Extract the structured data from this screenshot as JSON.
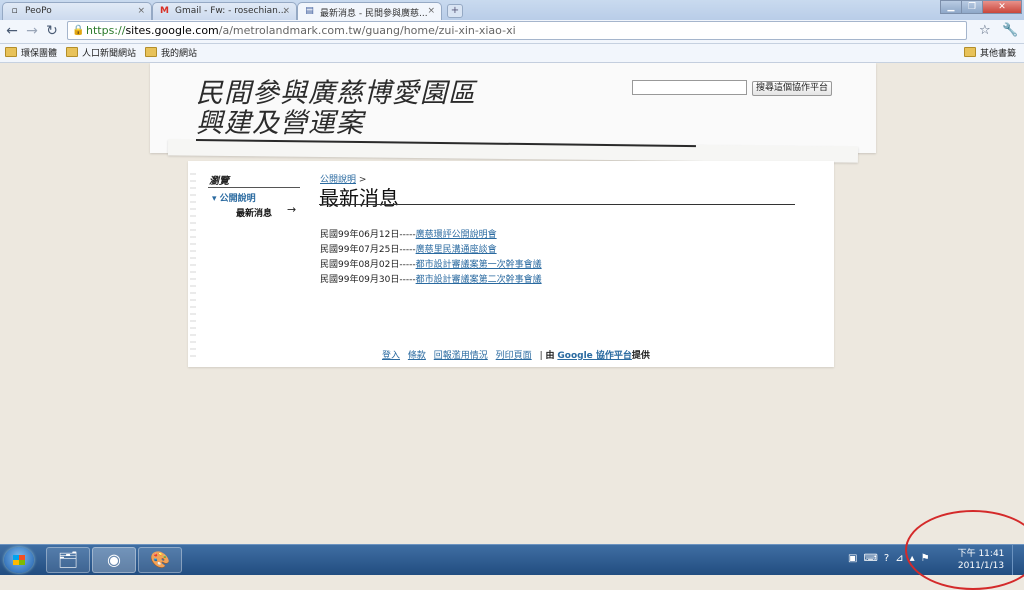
{
  "tabs": [
    {
      "title": "PeoPo",
      "icon": "page-icon"
    },
    {
      "title": "Gmail - Fw: - rosechian...",
      "icon": "gmail-icon"
    },
    {
      "title": "最新消息 - 民間參與廣慈...",
      "icon": "sites-icon"
    }
  ],
  "toolbar": {
    "url_secure": "https://",
    "url_host": "sites.google.com",
    "url_path": "/a/metrolandmark.com.tw/guang/home/zui-xin-xiao-xi"
  },
  "bookmarks": [
    "環保團體",
    "人口新聞網站",
    "我的網站"
  ],
  "other_bookmarks": "其他書籤",
  "site": {
    "title_line1": "民間參與廣慈博愛園區",
    "title_line2": "興建及營運案",
    "search_button": "搜尋這個協作平台"
  },
  "nav": {
    "title": "瀏覽",
    "item": "公開說明",
    "subitem": "最新消息"
  },
  "breadcrumb": {
    "link": "公開說明",
    "sep": " >"
  },
  "page_title": "最新消息",
  "news": [
    {
      "date": "民國99年06月12日-----",
      "link": "廣慈環評公開說明會"
    },
    {
      "date": "民國99年07月25日-----",
      "link": "廣慈里民溝通座談會"
    },
    {
      "date": "民國99年08月02日-----",
      "link": "都市設計審議案第一次幹事會議"
    },
    {
      "date": "民國99年09月30日-----",
      "link": "都市設計審議案第二次幹事會議"
    }
  ],
  "footer": {
    "links": [
      "登入",
      "條款",
      "回報濫用情況",
      "列印頁面"
    ],
    "sep": "|",
    "by": "由",
    "google_link": "Google 協作平台",
    "provided": "提供"
  },
  "clock": {
    "time": "下午 11:41",
    "date": "2011/1/13"
  },
  "colors": {
    "accent": "#2a6aa0",
    "annotation": "#d42a2a"
  }
}
